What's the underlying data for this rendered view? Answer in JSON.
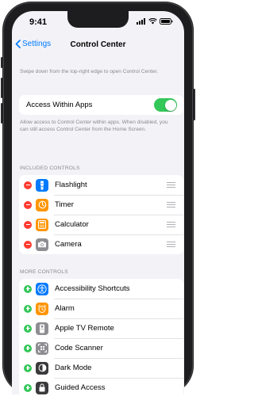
{
  "status": {
    "time": "9:41"
  },
  "nav": {
    "back_label": "Settings",
    "title": "Control Center"
  },
  "intro_text": "Swipe down from the top-right edge to open Control Center.",
  "access_within_apps": {
    "label": "Access Within Apps",
    "enabled": true,
    "footer": "Allow access to Control Center within apps. When disabled, you can still access Control Center from the Home Screen."
  },
  "included_controls": {
    "header": "INCLUDED CONTROLS",
    "items": [
      {
        "label": "Flashlight",
        "icon": "flashlight-icon",
        "color": "#007aff"
      },
      {
        "label": "Timer",
        "icon": "timer-icon",
        "color": "#ff9500"
      },
      {
        "label": "Calculator",
        "icon": "calculator-icon",
        "color": "#ff9500"
      },
      {
        "label": "Camera",
        "icon": "camera-icon",
        "color": "#8e8e93"
      }
    ]
  },
  "more_controls": {
    "header": "MORE CONTROLS",
    "items": [
      {
        "label": "Accessibility Shortcuts",
        "icon": "accessibility-icon",
        "color": "#007aff"
      },
      {
        "label": "Alarm",
        "icon": "alarm-icon",
        "color": "#ff9500"
      },
      {
        "label": "Apple TV Remote",
        "icon": "tv-remote-icon",
        "color": "#8e8e93"
      },
      {
        "label": "Code Scanner",
        "icon": "qr-code-icon",
        "color": "#8e8e93"
      },
      {
        "label": "Dark Mode",
        "icon": "dark-mode-icon",
        "color": "#3a3a3c"
      },
      {
        "label": "Guided Access",
        "icon": "guided-access-icon",
        "color": "#3a3a3c"
      }
    ]
  },
  "colors": {
    "accent": "#007aff",
    "remove": "#ff3b30",
    "add": "#34c759",
    "toggle_on": "#34c759"
  }
}
